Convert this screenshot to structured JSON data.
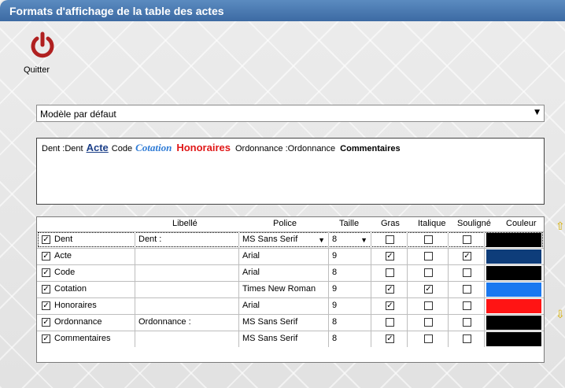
{
  "window": {
    "title": "Formats d'affichage de la table des actes"
  },
  "toolbar": {
    "quit_label": "Quitter",
    "quit_icon": "power-icon",
    "quit_color": "#b02020"
  },
  "model_select": {
    "value": "Modèle par défaut"
  },
  "preview": {
    "dent": "Dent :Dent",
    "acte": "Acte",
    "code": "Code",
    "cotation": "Cotation",
    "honoraires": "Honoraires",
    "ordonnance": "Ordonnance :Ordonnance",
    "commentaires": "Commentaires"
  },
  "table": {
    "headers": [
      "Libellé",
      "Police",
      "Taille",
      "Gras",
      "Italique",
      "Souligné",
      "Couleur"
    ],
    "rows": [
      {
        "checked": true,
        "name": "Dent",
        "libelle": "Dent :",
        "police": "MS Sans Serif",
        "taille": "8",
        "gras": false,
        "italique": false,
        "souligne": false,
        "couleur": "#000000"
      },
      {
        "checked": true,
        "name": "Acte",
        "libelle": "",
        "police": "Arial",
        "taille": "9",
        "gras": true,
        "italique": false,
        "souligne": true,
        "couleur": "#0e3d7a"
      },
      {
        "checked": true,
        "name": "Code",
        "libelle": "",
        "police": "Arial",
        "taille": "8",
        "gras": false,
        "italique": false,
        "souligne": false,
        "couleur": "#000000"
      },
      {
        "checked": true,
        "name": "Cotation",
        "libelle": "",
        "police": "Times New Roman",
        "taille": "9",
        "gras": true,
        "italique": true,
        "souligne": false,
        "couleur": "#1a78f0"
      },
      {
        "checked": true,
        "name": "Honoraires",
        "libelle": "",
        "police": "Arial",
        "taille": "9",
        "gras": true,
        "italique": false,
        "souligne": false,
        "couleur": "#ff1414"
      },
      {
        "checked": true,
        "name": "Ordonnance",
        "libelle": "Ordonnance :",
        "police": "MS Sans Serif",
        "taille": "8",
        "gras": false,
        "italique": false,
        "souligne": false,
        "couleur": "#000000"
      },
      {
        "checked": true,
        "name": "Commentaires",
        "libelle": "",
        "police": "MS Sans Serif",
        "taille": "8",
        "gras": true,
        "italique": false,
        "souligne": false,
        "couleur": "#000000"
      }
    ]
  },
  "side_arrows": {
    "up_icon": "arrow-up-icon",
    "down_icon": "arrow-down-icon",
    "color": "#d8b000"
  }
}
